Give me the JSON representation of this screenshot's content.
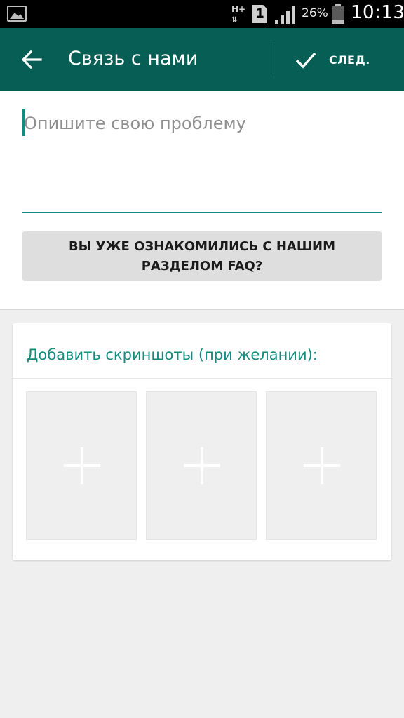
{
  "status_bar": {
    "network": "H+",
    "sim_slot": "1",
    "battery_percent": "26%",
    "battery_level": 0.26,
    "time": "10:13",
    "icons": [
      "gallery-icon",
      "network-type-icon",
      "sim-icon",
      "signal-icon",
      "battery-icon"
    ]
  },
  "toolbar": {
    "title": "Связь с нами",
    "next_label": "СЛЕД.",
    "back_icon": "arrow-left-icon",
    "next_icon": "check-icon"
  },
  "problem": {
    "placeholder": "Опишите свою проблему",
    "value": ""
  },
  "faq_button": {
    "label": "ВЫ УЖЕ ОЗНАКОМИЛИСЬ С НАШИМ РАЗДЕЛОМ FAQ?"
  },
  "screenshots": {
    "heading": "Добавить скриншоты (при желании):",
    "slots": [
      {
        "icon": "plus-icon"
      },
      {
        "icon": "plus-icon"
      },
      {
        "icon": "plus-icon"
      }
    ]
  },
  "colors": {
    "toolbar": "#075e54",
    "accent": "#128c7e",
    "background": "#efefef"
  }
}
